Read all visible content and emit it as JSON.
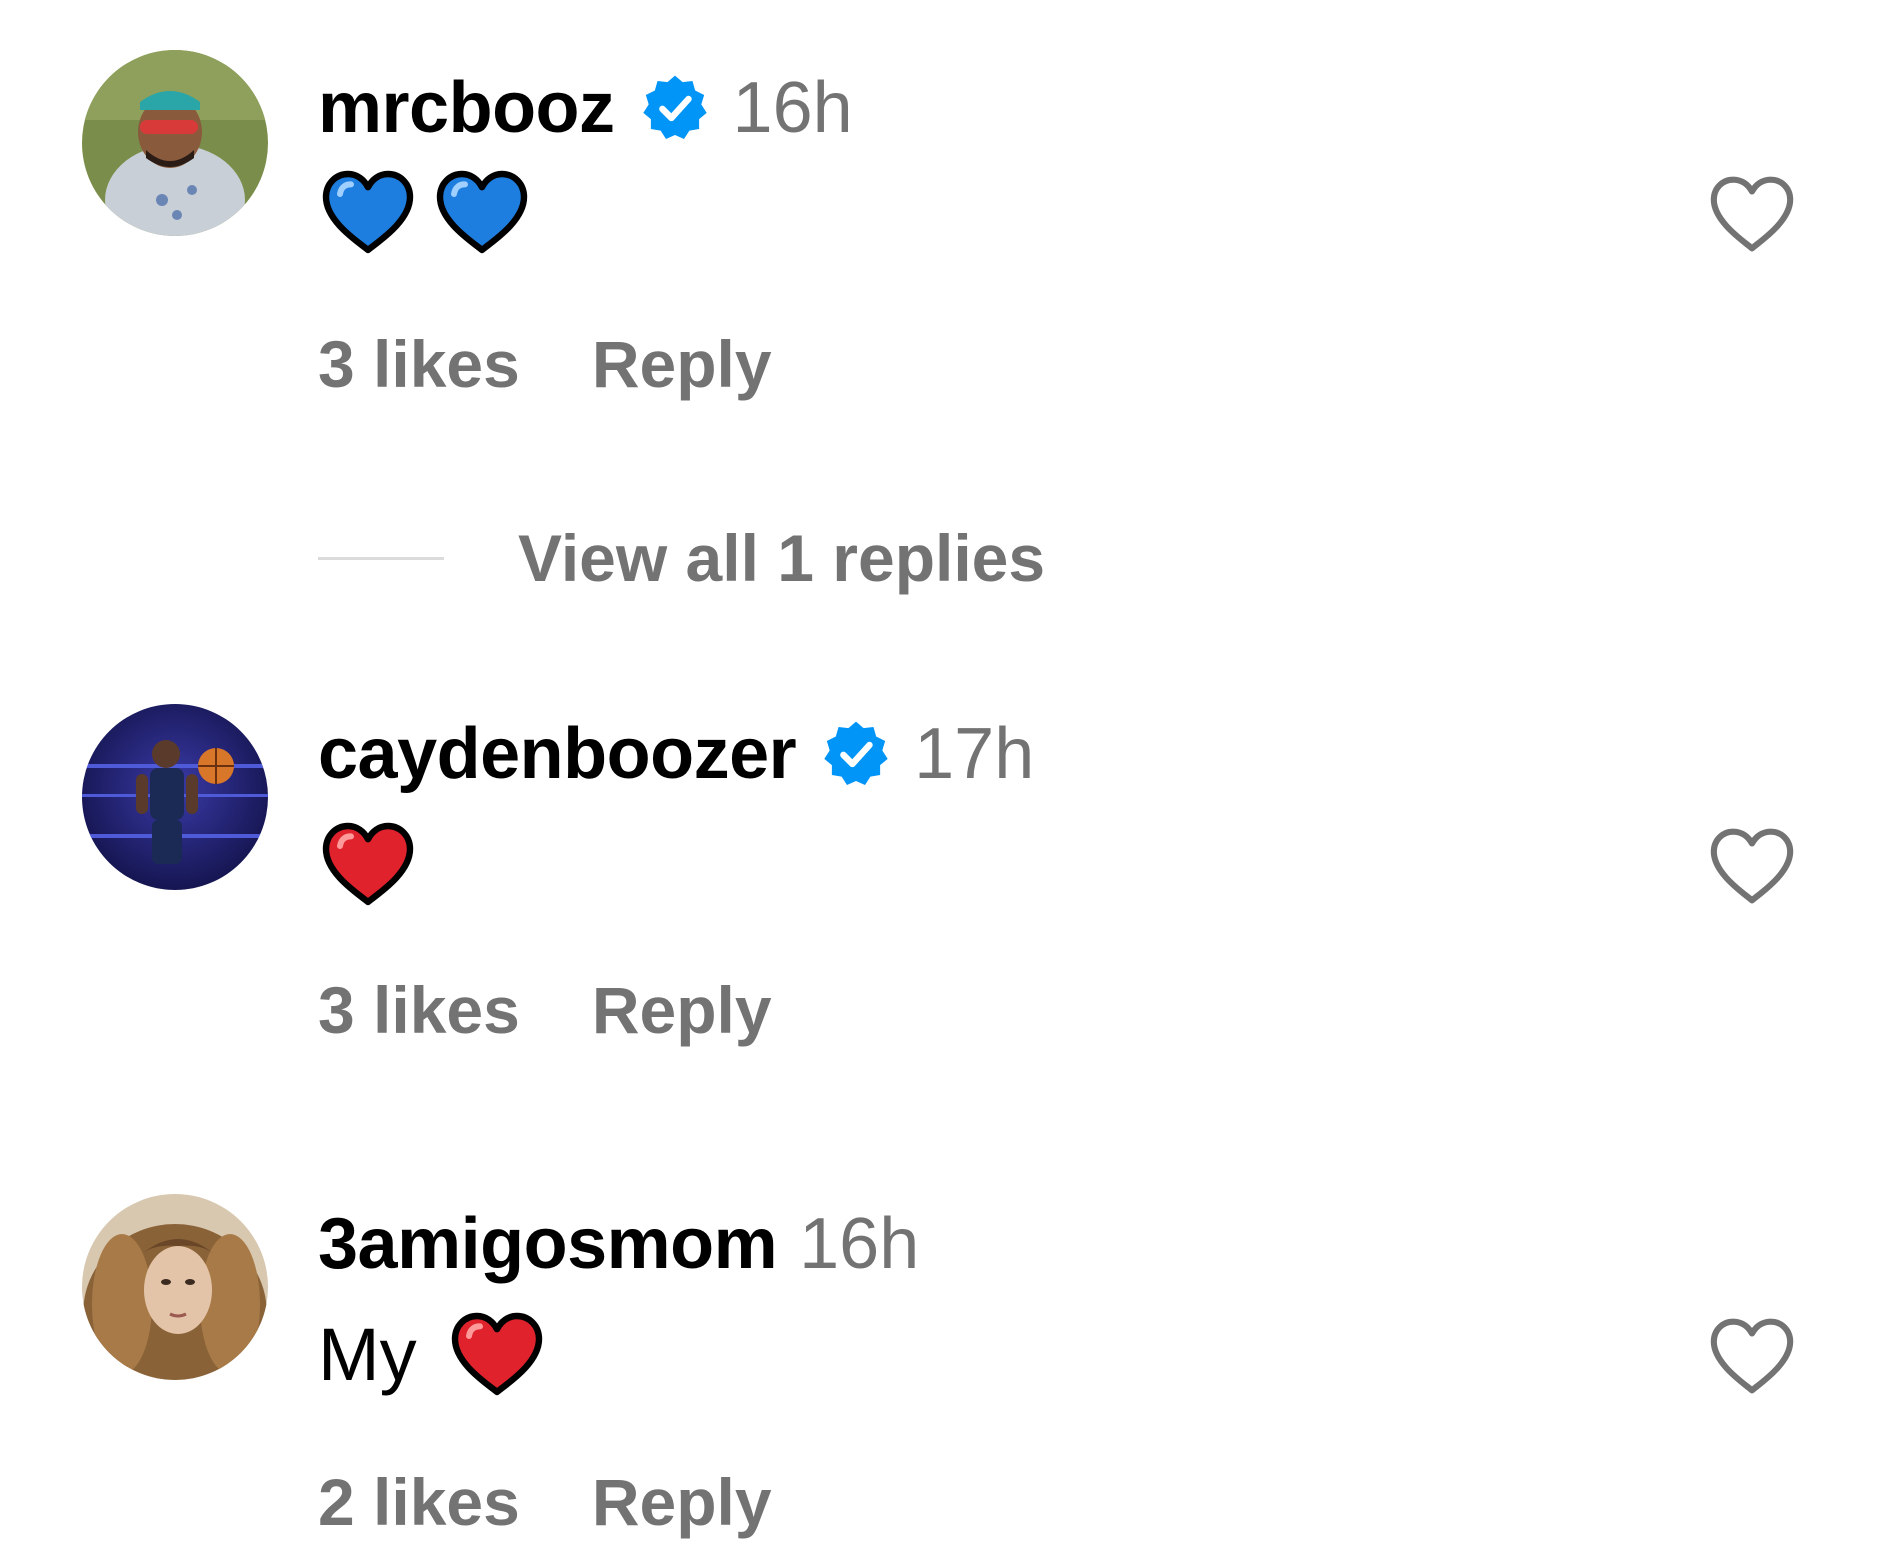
{
  "comments": [
    {
      "username": "mrcbooz",
      "verified": true,
      "timestamp": "16h",
      "text": "",
      "emojis": [
        "blue-heart",
        "blue-heart"
      ],
      "likes_label": "3 likes",
      "reply_label": "Reply",
      "view_replies_label": "View all 1 replies"
    },
    {
      "username": "caydenboozer",
      "verified": true,
      "timestamp": "17h",
      "text": "",
      "emojis": [
        "red-heart"
      ],
      "likes_label": "3 likes",
      "reply_label": "Reply"
    },
    {
      "username": "3amigosmom",
      "verified": false,
      "timestamp": "16h",
      "text": "My",
      "emojis": [
        "red-heart"
      ],
      "likes_label": "2 likes",
      "reply_label": "Reply"
    }
  ],
  "colors": {
    "username": "#000000",
    "secondary_text": "#737373",
    "verified_badge": "#0095f6",
    "blue_heart": "#1e7ee0",
    "red_heart": "#e0222d",
    "divider": "#dbdbdb"
  },
  "icons": {
    "like": "heart-outline-icon",
    "verified": "verified-badge-icon"
  }
}
